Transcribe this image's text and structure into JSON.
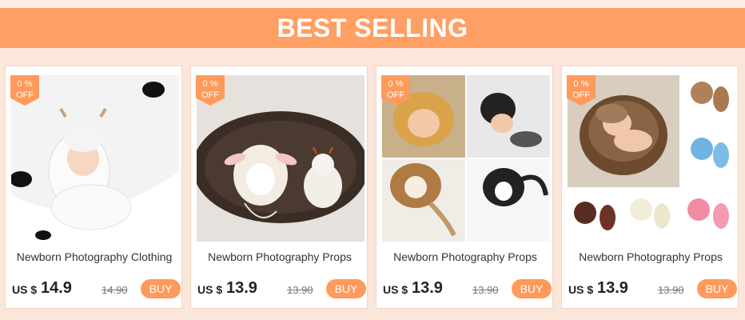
{
  "banner": {
    "title": "BEST SELLING"
  },
  "products": [
    {
      "badge": "0 %\nOFF",
      "badge_line1": "0 %",
      "badge_line2": "OFF",
      "title": "Newborn Photography Clothing",
      "currency": "US $",
      "price": "14.9",
      "original_price": "14.90",
      "buy_label": "BUY"
    },
    {
      "badge_line1": "0 %",
      "badge_line2": "OFF",
      "title": "Newborn Photography Props",
      "currency": "US $",
      "price": "13.9",
      "original_price": "13.90",
      "buy_label": "BUY"
    },
    {
      "badge_line1": "0 %",
      "badge_line2": "OFF",
      "title": "Newborn Photography Props",
      "currency": "US $",
      "price": "13.9",
      "original_price": "13.90",
      "buy_label": "BUY"
    },
    {
      "badge_line1": "0 %",
      "badge_line2": "OFF",
      "title": "Newborn Photography Props",
      "currency": "US $",
      "price": "13.9",
      "original_price": "13.90",
      "buy_label": "BUY"
    }
  ],
  "colors": {
    "accent": "#ff9f63",
    "background": "#fbe6da"
  }
}
